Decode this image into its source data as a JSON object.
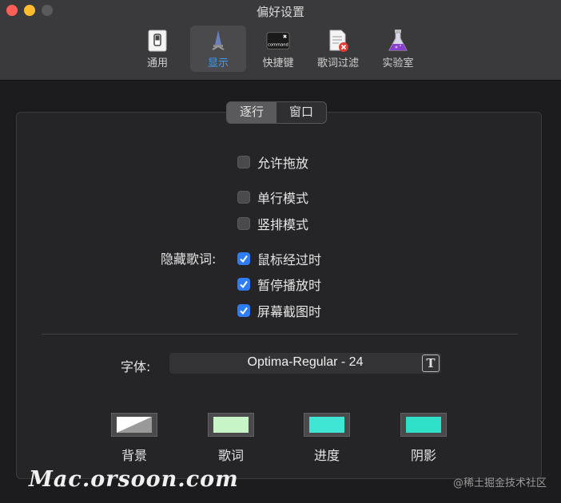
{
  "window": {
    "title": "偏好设置"
  },
  "toolbar": {
    "items": [
      {
        "label": "通用",
        "icon": "general-switch-icon"
      },
      {
        "label": "显示",
        "icon": "display-icon",
        "active": true
      },
      {
        "label": "快捷键",
        "icon": "command-key-icon"
      },
      {
        "label": "歌词过滤",
        "icon": "lyrics-filter-icon"
      },
      {
        "label": "实验室",
        "icon": "flask-icon"
      }
    ]
  },
  "segments": {
    "left": "逐行",
    "right": "窗口",
    "selected": "逐行"
  },
  "options": {
    "allow_drag": {
      "label": "允许拖放",
      "checked": false
    },
    "single_line": {
      "label": "单行模式",
      "checked": false
    },
    "vertical": {
      "label": "竖排模式",
      "checked": false
    }
  },
  "hide_lyrics": {
    "label": "隐藏歌词:",
    "mouse_over": {
      "label": "鼠标经过时",
      "checked": true
    },
    "paused": {
      "label": "暂停播放时",
      "checked": true
    },
    "screenshot": {
      "label": "屏幕截图时",
      "checked": true
    }
  },
  "font": {
    "label": "字体:",
    "value": "Optima-Regular - 24"
  },
  "colors": {
    "background": {
      "label": "背景",
      "color": "gradient-white-gray"
    },
    "lyrics": {
      "label": "歌词",
      "color": "#c8f5c8"
    },
    "progress": {
      "label": "进度",
      "color": "#3fe6d4"
    },
    "shadow": {
      "label": "阴影",
      "color": "#2fe0c8"
    }
  },
  "watermarks": {
    "left": "Mac.orsoon.com",
    "right": "@稀土掘金技术社区"
  }
}
